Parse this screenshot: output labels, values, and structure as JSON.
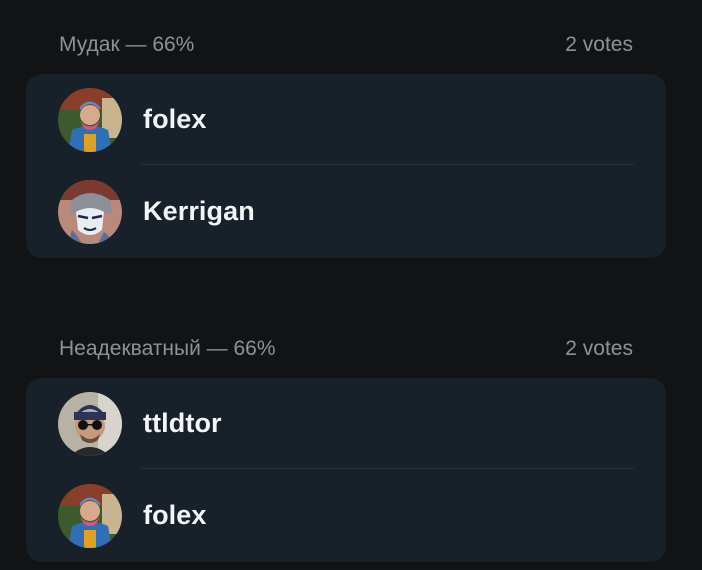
{
  "results": [
    {
      "option_label": "Мудак — 66%",
      "votes_label": "2 votes",
      "voters": [
        {
          "name": "folex",
          "avatar_icon": "folex-avatar"
        },
        {
          "name": "Kerrigan",
          "avatar_icon": "kerrigan-avatar"
        }
      ]
    },
    {
      "option_label": "Неадекватный — 66%",
      "votes_label": "2 votes",
      "voters": [
        {
          "name": "ttldtor",
          "avatar_icon": "ttldtor-avatar"
        },
        {
          "name": "folex",
          "avatar_icon": "folex-avatar"
        }
      ]
    }
  ],
  "colors": {
    "background": "#121314",
    "card": "#18202a",
    "header_text": "#8d9298",
    "name_text": "#f3f5f7",
    "divider": "#2a3440"
  }
}
